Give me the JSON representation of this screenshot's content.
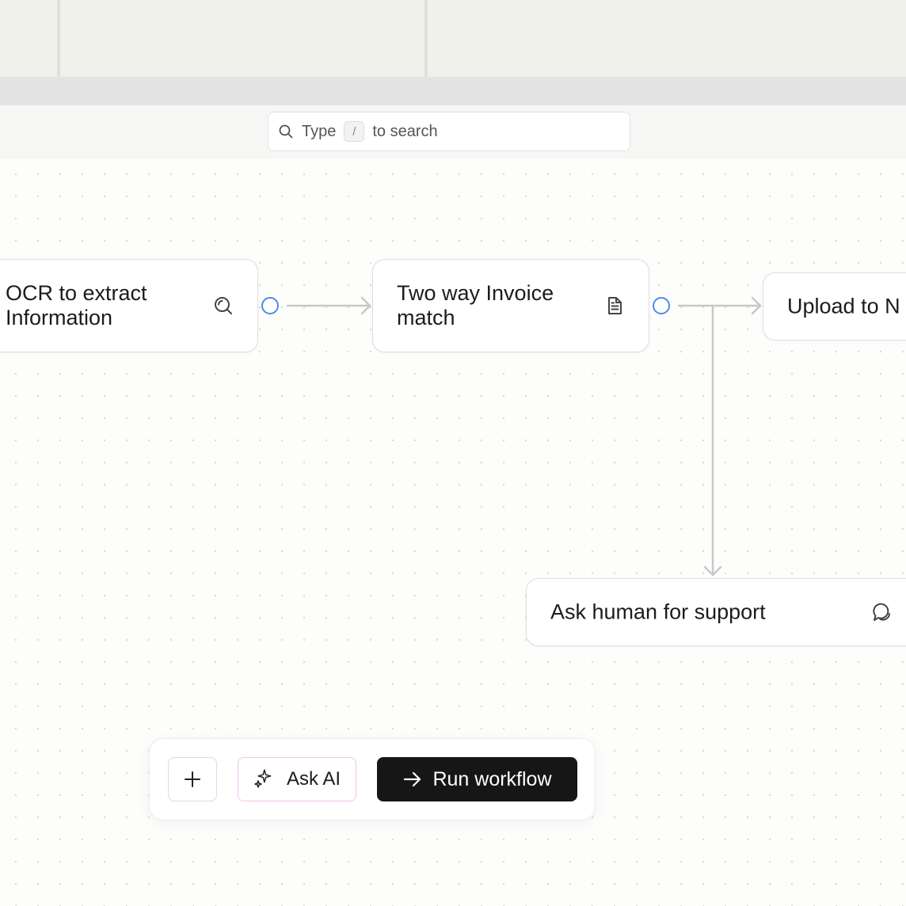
{
  "search": {
    "prefix": "Type",
    "shortcut": "/",
    "suffix": "to search"
  },
  "nodes": {
    "ocr": {
      "label": "OCR to extract\nInformation",
      "icon": "scan-search-icon"
    },
    "invoice": {
      "label": "Two way Invoice\nmatch",
      "icon": "document-icon"
    },
    "upload": {
      "label": "Upload to N"
    },
    "human": {
      "label": "Ask human for support",
      "icon": "chat-bubble-icon"
    }
  },
  "toolbar": {
    "add_icon": "plus-icon",
    "ask_ai_label": "Ask AI",
    "run_label": "Run workflow"
  },
  "colors": {
    "port": "#4a8cf0",
    "edge": "#c8c8c8",
    "run_button": "#161616",
    "ask_ai_border": "#f0c4ec"
  }
}
